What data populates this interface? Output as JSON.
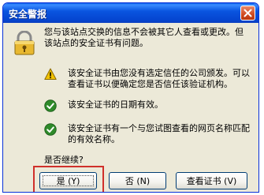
{
  "window": {
    "title": "安全警报"
  },
  "intro_text": "您与该站点交换的信息不会被其它人查看或更改。但该站点的安全证书有问题。",
  "items": [
    {
      "icon": "warning-icon",
      "text": "该安全证书由您没有选定信任的公司颁发。可以查看证书以便确定您是否信任该验证机构。"
    },
    {
      "icon": "check-icon",
      "text": "该安全证书的日期有效。"
    },
    {
      "icon": "check-icon",
      "text": "该安全证书有一个与您试图查看的网页名称匹配的有效名称。"
    }
  ],
  "question": "是否继续?",
  "buttons": {
    "yes": "是 (Y)",
    "no": "否 (N)",
    "view_cert": "查看证书 (V)"
  },
  "colors": {
    "title_bar": "#0a55e0",
    "window_bg": "#ece9d8",
    "warning": "#f2c200",
    "check": "#2f8a2a",
    "highlight_frame": "#d0302a"
  }
}
